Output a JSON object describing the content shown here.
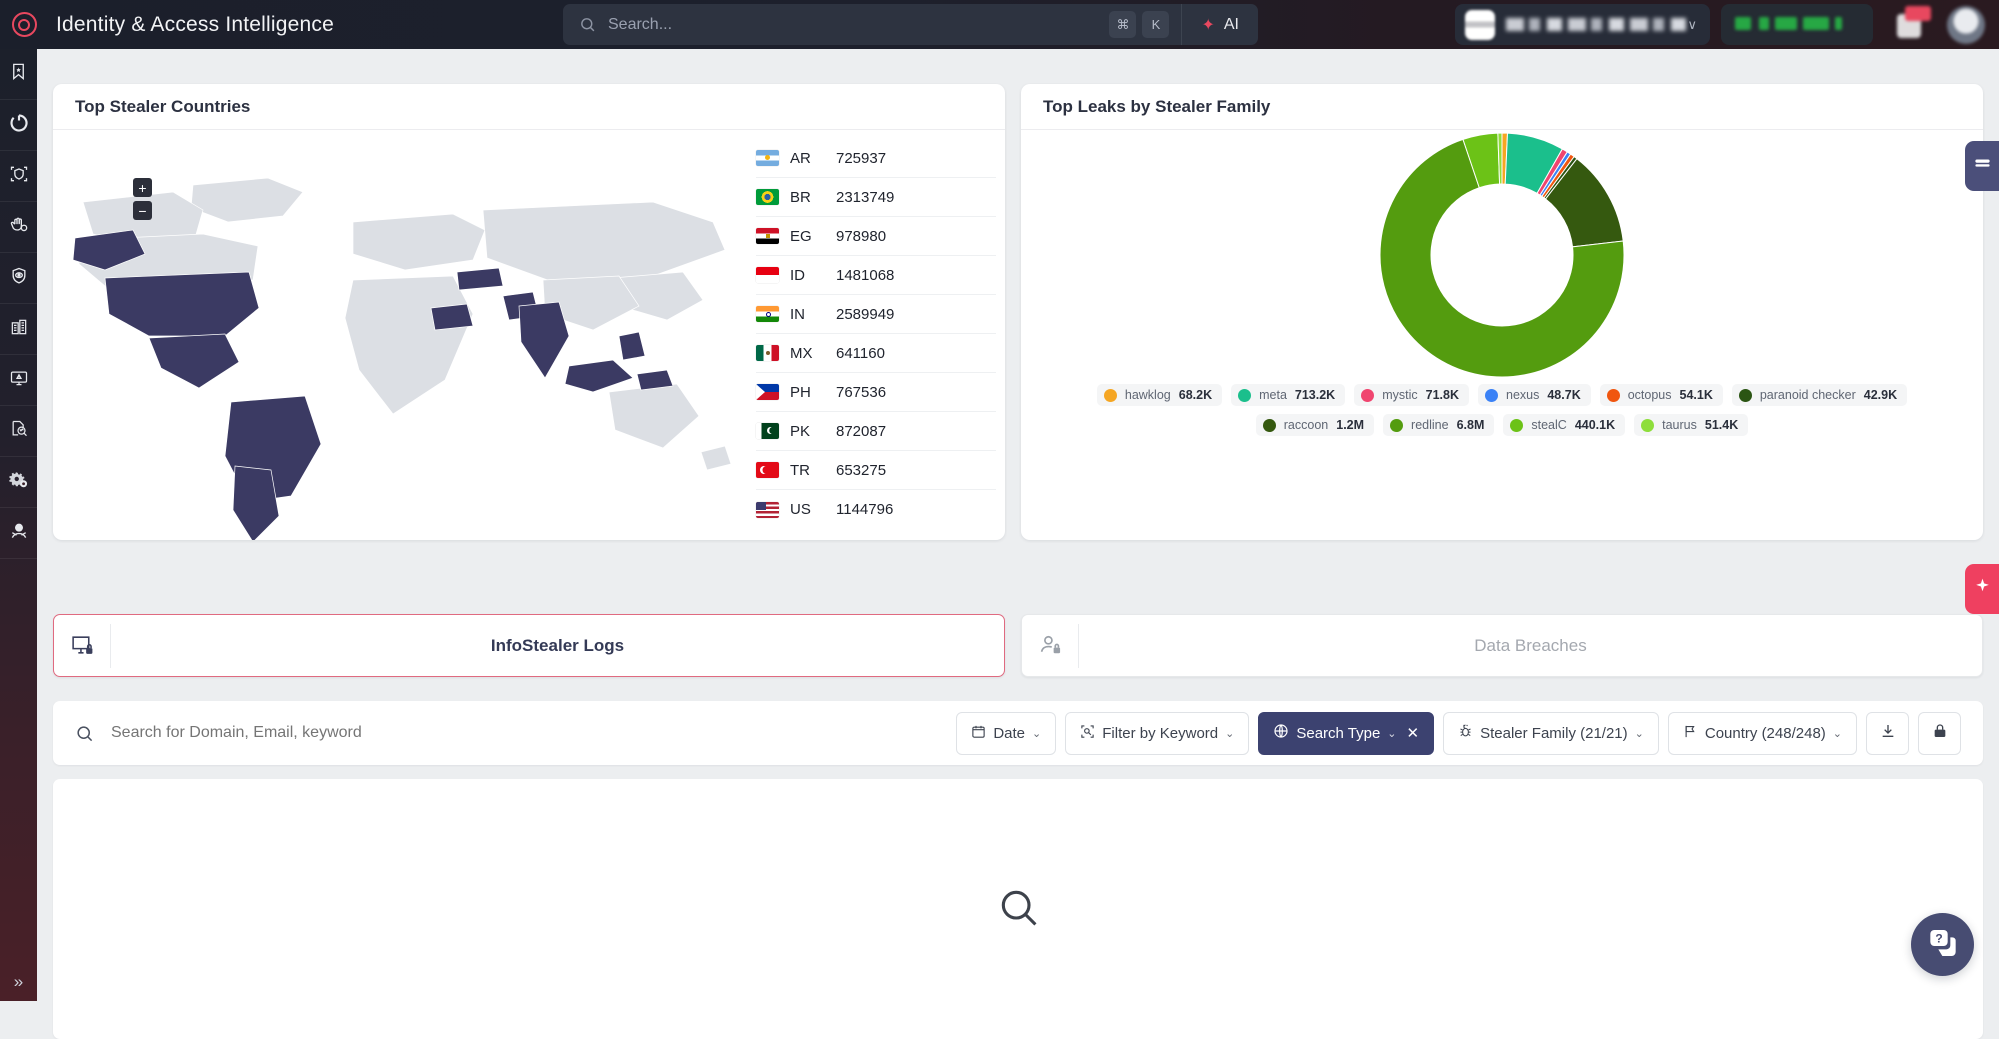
{
  "header": {
    "app_title": "Identity & Access Intelligence",
    "logo_icon": "target-ring-icon",
    "search": {
      "placeholder": "Search...",
      "icon": "search-icon"
    },
    "shortcut": {
      "modifier": "⌘",
      "key": "K"
    },
    "ai_button": {
      "label": "AI",
      "icon": "sparkle-icon"
    },
    "account": {
      "chevron": "∨",
      "redacted": true
    },
    "icons": {
      "notifications": "bell-icon",
      "avatar": "user-avatar"
    }
  },
  "sidebar": {
    "items": [
      {
        "name": "bookmark-star",
        "glyph": "bookmark"
      },
      {
        "name": "refresh-circle",
        "glyph": "refresh"
      },
      {
        "name": "shield-scan",
        "glyph": "shield-scan"
      },
      {
        "name": "hand-shield",
        "glyph": "hand-shield"
      },
      {
        "name": "eye-shield",
        "glyph": "eye-shield"
      },
      {
        "name": "building",
        "glyph": "building"
      },
      {
        "name": "monitor-alert",
        "glyph": "monitor-alert"
      },
      {
        "name": "document-search",
        "glyph": "doc-search"
      },
      {
        "name": "gears",
        "glyph": "gears"
      },
      {
        "name": "hacker",
        "glyph": "hacker"
      }
    ],
    "collapse_glyph": "»"
  },
  "countries_panel": {
    "title": "Top Stealer Countries",
    "zoom_in": "+",
    "zoom_out": "−",
    "rows": [
      {
        "code": "AR",
        "value": "725937",
        "flag": "ar"
      },
      {
        "code": "BR",
        "value": "2313749",
        "flag": "br"
      },
      {
        "code": "EG",
        "value": "978980",
        "flag": "eg"
      },
      {
        "code": "ID",
        "value": "1481068",
        "flag": "id"
      },
      {
        "code": "IN",
        "value": "2589949",
        "flag": "in"
      },
      {
        "code": "MX",
        "value": "641160",
        "flag": "mx"
      },
      {
        "code": "PH",
        "value": "767536",
        "flag": "ph"
      },
      {
        "code": "PK",
        "value": "872087",
        "flag": "pk"
      },
      {
        "code": "TR",
        "value": "653275",
        "flag": "tr"
      },
      {
        "code": "US",
        "value": "1144796",
        "flag": "us"
      }
    ]
  },
  "families_panel": {
    "title": "Top Leaks by Stealer Family"
  },
  "chart_data": {
    "type": "pie",
    "title": "Top Leaks by Stealer Family",
    "subtitle": "",
    "legend_position": "bottom",
    "donut": true,
    "categories": [
      "hawklog",
      "meta",
      "mystic",
      "nexus",
      "octopus",
      "paranoid checker",
      "raccoon",
      "redline",
      "stealC",
      "taurus"
    ],
    "labels": [
      "68.2K",
      "713.2K",
      "71.8K",
      "48.7K",
      "54.1K",
      "42.9K",
      "1.2M",
      "6.8M",
      "440.1K",
      "51.4K"
    ],
    "values": [
      68200,
      713200,
      71800,
      48700,
      54100,
      42900,
      1200000,
      6800000,
      440100,
      51400
    ],
    "colors": [
      "#f5a623",
      "#1bbf8c",
      "#f0456f",
      "#3b82f6",
      "#f0560f",
      "#2b5513",
      "#35590f",
      "#549c0f",
      "#6cc217",
      "#8ede3b"
    ],
    "units": "leaks"
  },
  "tabs": [
    {
      "label": "InfoStealer Logs",
      "icon": "monitor-lock-icon",
      "active": true
    },
    {
      "label": "Data Breaches",
      "icon": "user-lock-icon",
      "active": false
    }
  ],
  "search_bar": {
    "placeholder": "Search for Domain, Email, keyword",
    "icon": "search-icon",
    "filters": [
      {
        "label": "Date",
        "icon": "calendar-icon",
        "chevron": "⌄",
        "active": false,
        "closable": false
      },
      {
        "label": "Filter by Keyword",
        "icon": "keyword-icon",
        "chevron": "⌄",
        "active": false,
        "closable": false
      },
      {
        "label": "Search Type",
        "icon": "globe-icon",
        "chevron": "⌄",
        "active": true,
        "closable": true,
        "close": "✕"
      },
      {
        "label": "Stealer Family (21/21)",
        "icon": "bug-icon",
        "chevron": "⌄",
        "active": false,
        "closable": false
      },
      {
        "label": "Country (248/248)",
        "icon": "flag-icon",
        "chevron": "⌄",
        "active": false,
        "closable": false
      }
    ],
    "actions": [
      {
        "name": "download-button",
        "icon": "download-icon"
      },
      {
        "name": "lock-button",
        "icon": "lock-icon"
      }
    ]
  },
  "results": {
    "empty_icon": "search-icon-large"
  },
  "floating": {
    "feedback": {
      "icon": "feedback-icon"
    },
    "sparkle": {
      "icon": "sparkle-icon"
    },
    "chat": {
      "icon": "help-chat-icon"
    }
  },
  "colors": {
    "accent_red": "#e8485f",
    "navy": "#3c4270",
    "map_land": "#dcdfe4",
    "map_highlight": "#3b3a63"
  }
}
